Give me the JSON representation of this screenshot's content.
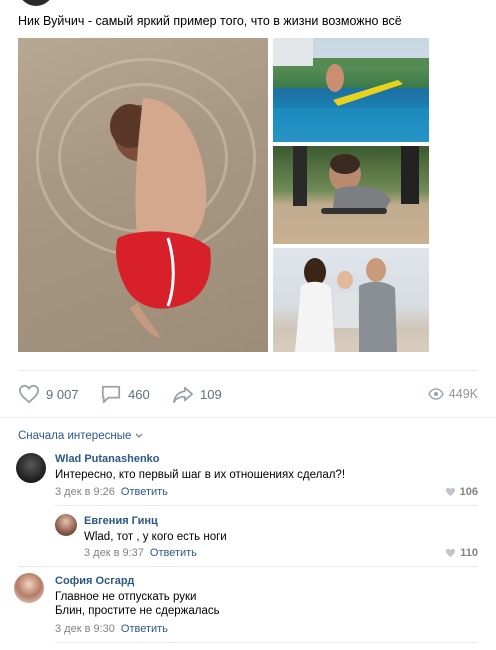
{
  "post": {
    "text": "Ник Вуйчич - самый яркий пример того, что в жизни возможно всё"
  },
  "actions": {
    "likes": "9 007",
    "comments": "460",
    "shares": "109",
    "views": "449K"
  },
  "comments_sort": "Сначала интересные",
  "comments": [
    {
      "author": "Wlad Putanashenko",
      "text": "Интересно, кто первый шаг в их отношениях сделал?!",
      "date": "3 дек в 9:26",
      "reply_label": "Ответить",
      "likes": "106"
    },
    {
      "author": "Евгения Гинц",
      "text": "Wlad, тот , у кого есть ноги",
      "date": "3 дек в 9:37",
      "reply_label": "Ответить",
      "likes": "110"
    },
    {
      "author": "София Осгард",
      "text_line1": "Главное не отпускать руки",
      "text_line2": "Блин, простите не сдержалась",
      "date": "3 дек в 9:30",
      "reply_label": "Ответить"
    }
  ],
  "colors": {
    "link": "#2a5885",
    "meta": "#828282",
    "divider": "#e7e8ec",
    "action_icon": "#99a2ad"
  }
}
